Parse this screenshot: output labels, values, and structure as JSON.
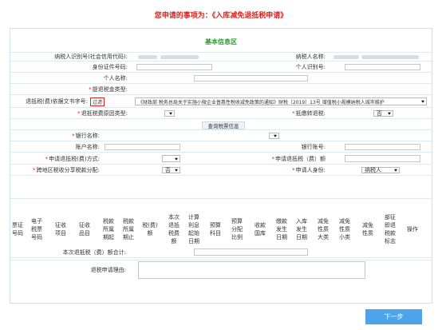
{
  "page": {
    "title": "您申请的事项为：《入库减免退抵税申请》",
    "section_title": "基本信息区",
    "next_label": "下一步"
  },
  "fields": {
    "taxpayer_id_label": "纳税人识别号(社会信用代码):",
    "taxpayer_name_label": "纳税人名称:",
    "id_number_label": "身份证件号码:",
    "person_tax_id_label": "个人识别号:",
    "person_name_label": "个人名称:",
    "refund_fund_type_label": "提退税金类型:",
    "doc_number_label": "退抵税(费)依据文书字号:",
    "filter_label": "过滤",
    "doc_number_value": "《财政部 税务总局关于实施小微企业普惠性税收减免政策的通知》财税〔2019〕13号 增值税小规模纳税人城市维护",
    "refund_reason_type_label": "退抵税费原因类型:",
    "offset_tax_label": "抵缴转退税:",
    "offset_tax_value": "否",
    "query_button_label": "查询税票信息",
    "bank_name_label": "银行名称:",
    "account_name_label": "账户名称:",
    "account_number_label": "银行账号:",
    "refund_method_label": "申请退抵税(费)方式:",
    "refund_amount_label": "申请退抵税（费）额",
    "cross_region_label": "跨地区税收分享税款分配:",
    "cross_region_value": "否",
    "applicant_identity_label": "申请人身份:",
    "applicant_identity_value": "纳税人",
    "current_total_label": "本次退抵税（费）额合计:",
    "reason_label": "退税申请理由:"
  },
  "table": {
    "columns": [
      "票证\n号码",
      "电子\n税票\n号码",
      "征收\n项目",
      "征收\n品目",
      "税款\n所属\n期起",
      "税款\n所属\n期止",
      "税(费)\n额",
      "本次\n退抵\n税费\n额",
      "计算\n利息\n起始\n日期",
      "预算\n科目",
      "预算\n分配\n比例",
      "收款\n国库",
      "缴款\n发生\n日期",
      "入库\n发生\n日期",
      "减免\n性质\n大类",
      "减免\n性质\n小类",
      "减免\n性质",
      "部征\n即退\n税款\n标志",
      "操作"
    ]
  }
}
